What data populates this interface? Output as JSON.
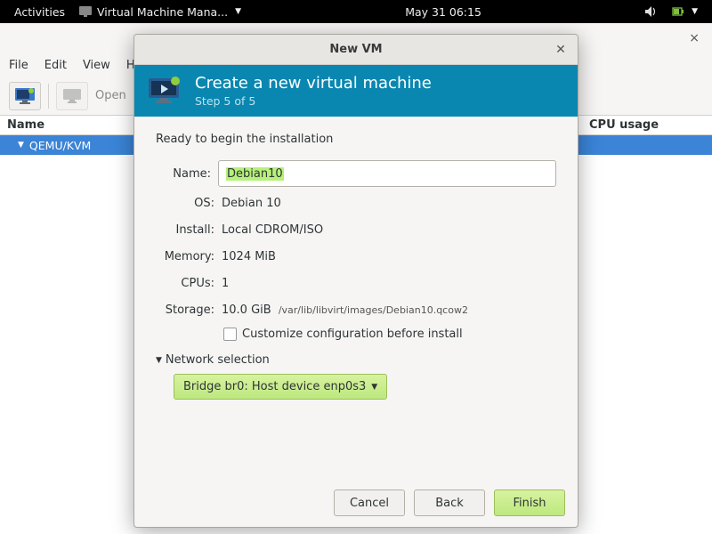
{
  "topbar": {
    "activities": "Activities",
    "app_menu": "Virtual Machine Mana...",
    "clock": "May 31 06:15"
  },
  "vmm": {
    "menubar": [
      "File",
      "Edit",
      "View",
      "H"
    ],
    "toolbar": {
      "open_label": "Open"
    },
    "columns": {
      "name": "Name",
      "cpu": "CPU usage"
    },
    "rows": [
      {
        "label": "QEMU/KVM"
      }
    ],
    "close_glyph": "×"
  },
  "dialog": {
    "title": "New VM",
    "header_title": "Create a new virtual machine",
    "header_sub": "Step 5 of 5",
    "ready": "Ready to begin the installation",
    "fields": {
      "name_label": "Name:",
      "name_value": "Debian10",
      "os_label": "OS:",
      "os_value": "Debian 10",
      "install_label": "Install:",
      "install_value": "Local CDROM/ISO",
      "memory_label": "Memory:",
      "memory_value": "1024 MiB",
      "cpus_label": "CPUs:",
      "cpus_value": "1",
      "storage_label": "Storage:",
      "storage_value": "10.0 GiB",
      "storage_path": "/var/lib/libvirt/images/Debian10.qcow2"
    },
    "customize_label": "Customize configuration before install",
    "network_header": "Network selection",
    "network_value": "Bridge br0: Host device enp0s3",
    "buttons": {
      "cancel": "Cancel",
      "back": "Back",
      "finish": "Finish"
    }
  }
}
